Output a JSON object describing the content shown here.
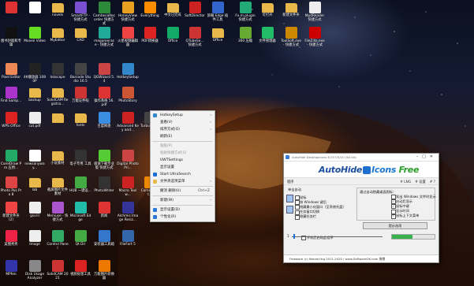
{
  "desktop": {
    "icons": [
      {
        "label": "",
        "icon": "app-icon",
        "color": "#d33"
      },
      {
        "label": "",
        "icon": "doc-icon",
        "color": "#fff"
      },
      {
        "label": "novels",
        "icon": "folder-icon",
        "color": "#e8b84a"
      },
      {
        "label": "SmartFTP - 快捷方式",
        "icon": "app-icon",
        "color": "#7a4fd0"
      },
      {
        "label": "CamtasiaRecorder 快捷方式",
        "icon": "app-icon",
        "color": "#2d8a3a"
      },
      {
        "label": "HoneyView 快捷方式",
        "icon": "app-icon",
        "color": "#e8a020"
      },
      {
        "label": "Everything",
        "icon": "search-icon",
        "color": "#ff8c00"
      },
      {
        "label": "中文已完成",
        "icon": "folder-icon",
        "color": "#e8b84a"
      },
      {
        "label": "SoftDirector",
        "icon": "app-icon",
        "color": "#c22"
      },
      {
        "label": "卸载 Edge 插件工具",
        "icon": "app-icon",
        "color": "#36c"
      },
      {
        "label": "Fx.m.plugin 快捷方式",
        "icon": "app-icon",
        "color": "#2a7"
      },
      {
        "label": "可打开",
        "icon": "folder-icon",
        "color": "#e8b84a"
      },
      {
        "label": "新建文件夹",
        "icon": "folder-icon",
        "color": "#e8b84a"
      },
      {
        "label": "Mp4Reader 快捷方式",
        "icon": "doc-icon",
        "color": "#eee"
      },
      {
        "label": "图书封面和专辑",
        "icon": "app-icon",
        "color": "#111"
      },
      {
        "label": "Moneil Video",
        "icon": "app-icon",
        "color": "#6d2"
      },
      {
        "label": "MyEditor",
        "icon": "folder-icon",
        "color": "#e8b84a"
      },
      {
        "label": "CAD",
        "icon": "folder-icon",
        "color": "#e8b84a"
      },
      {
        "label": "megamerase - 快捷方式",
        "icon": "app-icon",
        "color": "#2a9"
      },
      {
        "label": "火星视频编辑器",
        "icon": "app-icon",
        "color": "#e44"
      },
      {
        "label": "PDF转换器",
        "icon": "app-icon",
        "color": "#d22"
      },
      {
        "label": "Office",
        "icon": "app-icon",
        "color": "#1a6"
      },
      {
        "label": "QTubeSe... 快捷方式",
        "icon": "app-icon",
        "color": "#c33"
      },
      {
        "label": "Office",
        "icon": "folder-icon",
        "color": "#e8b84a"
      },
      {
        "label": "360 压缩",
        "icon": "app-icon",
        "color": "#6a3"
      },
      {
        "label": "文件管理器",
        "icon": "app-icon",
        "color": "#2b6"
      },
      {
        "label": "ToolSoft.exe - 快捷方式",
        "icon": "app-icon",
        "color": "#c80"
      },
      {
        "label": "FileZilla.exe - 快捷方式",
        "icon": "app-icon",
        "color": "#c00"
      },
      {
        "label": "Pixel Editor",
        "icon": "app-icon",
        "color": "#e85"
      },
      {
        "label": "4K播放器 1080P",
        "icon": "app-icon",
        "color": "#222"
      },
      {
        "label": "Inkscape",
        "icon": "app-icon",
        "color": "#333"
      },
      {
        "label": "Barcode Studio 16.5",
        "icon": "app-icon",
        "color": "#444"
      },
      {
        "label": "QGWizard 5.4",
        "icon": "app-icon",
        "color": "#c44"
      },
      {
        "label": "HotkeySetup",
        "icon": "app-icon",
        "color": "#38c"
      },
      {
        "label": "Find Samp...",
        "icon": "app-icon",
        "color": "#a3c"
      },
      {
        "label": "backup",
        "icon": "folder-icon",
        "color": "#e8b84a"
      },
      {
        "label": "SolidCAM Registra...",
        "icon": "folder-icon",
        "color": "#e8b84a"
      },
      {
        "label": "万能证件照",
        "icon": "app-icon",
        "color": "#c33"
      },
      {
        "label": "操作系统 56.pdf",
        "icon": "app-icon",
        "color": "#d33"
      },
      {
        "label": "PhotoStory",
        "icon": "app-icon",
        "color": "#c53"
      },
      {
        "label": "WPS Office",
        "icon": "app-icon",
        "color": "#d22"
      },
      {
        "label": "cut.pdf",
        "icon": "doc-icon",
        "color": "#eee"
      },
      {
        "label": "",
        "icon": "folder-icon",
        "color": "#e8b84a"
      },
      {
        "label": "fonts",
        "icon": "folder-icon",
        "color": "#e8b84a"
      },
      {
        "label": "百度网盘",
        "icon": "app-icon",
        "color": "#3a8de0"
      },
      {
        "label": "Advanced Key and...",
        "icon": "app-icon",
        "color": "#c22"
      },
      {
        "label": "TurboColl...",
        "icon": "app-icon",
        "color": "#444"
      },
      {
        "label": "CorelDraw Pro 应用...",
        "icon": "app-icon",
        "color": "#2a6"
      },
      {
        "label": "newsanyway...",
        "icon": "doc-icon",
        "color": "#fff"
      },
      {
        "label": "小说素材",
        "icon": "folder-icon",
        "color": "#e8b84a"
      },
      {
        "label": "电子专用 工具",
        "icon": "app-icon",
        "color": "#333"
      },
      {
        "label": "极速下载专业版 快捷方式",
        "icon": "app-icon",
        "color": "#5c3"
      },
      {
        "label": "Digital Photo Pri...",
        "icon": "app-icon",
        "color": "#c44"
      },
      {
        "label": "Photo Pos Pro 8",
        "icon": "app-icon",
        "color": "#d44"
      },
      {
        "label": "lab",
        "icon": "folder-icon",
        "color": "#e8b84a"
      },
      {
        "label": "截屏图片文件素材",
        "icon": "folder-icon",
        "color": "#e8b84a"
      },
      {
        "label": "HUB 一键设...",
        "icon": "app-icon",
        "color": "#4a4"
      },
      {
        "label": "PhotoWriter",
        "icon": "app-icon",
        "color": "#333"
      },
      {
        "label": "Macro Toolw...",
        "icon": "app-icon",
        "color": "#c22"
      },
      {
        "label": "Cornelicent...",
        "icon": "app-icon",
        "color": "#e80"
      },
      {
        "label": "新建文件夹 (2)",
        "icon": "app-icon",
        "color": "#e44"
      },
      {
        "label": "gsvril",
        "icon": "doc-icon",
        "color": "#eee"
      },
      {
        "label": "Mervuse - 快捷方式",
        "icon": "app-icon",
        "color": "#a5c"
      },
      {
        "label": "Microsoft Edge",
        "icon": "app-icon",
        "color": "#2ba"
      },
      {
        "label": "新闻",
        "icon": "app-icon",
        "color": "#d33"
      },
      {
        "label": "Alchmis Image Resiz...",
        "icon": "app-icon",
        "color": "#339"
      },
      {
        "label": "美图秀秀",
        "icon": "app-icon",
        "color": "#e24"
      },
      {
        "label": "Image",
        "icon": "doc-icon",
        "color": "#eee"
      },
      {
        "label": "Control Panel",
        "icon": "app-icon",
        "color": "#3a6"
      },
      {
        "label": "Qt Dir",
        "icon": "app-icon",
        "color": "#4a4"
      },
      {
        "label": "安装器工具箱",
        "icon": "app-icon",
        "color": "#37c"
      },
      {
        "label": "FileFort 5",
        "icon": "app-icon",
        "color": "#36a"
      },
      {
        "label": "MPfen",
        "icon": "app-icon",
        "color": "#33a"
      },
      {
        "label": "Disk Usage Analyzer",
        "icon": "app-icon",
        "color": "#888"
      },
      {
        "label": "SolidCAM 2021",
        "icon": "app-icon",
        "color": "#c33"
      },
      {
        "label": "视频处理工具",
        "icon": "app-icon",
        "color": "#d22"
      },
      {
        "label": "万能图片转换器",
        "icon": "app-icon",
        "color": "#e70"
      }
    ]
  },
  "context_menu": {
    "items": [
      {
        "label": "HotkeySetup",
        "icon": "app-icon",
        "icon_color": "#38c",
        "arrow": true,
        "disabled": false,
        "shortcut": ""
      },
      {
        "label": "查看(V)",
        "icon": "",
        "icon_color": "",
        "arrow": true,
        "disabled": false,
        "shortcut": ""
      },
      {
        "label": "排序方式(O)",
        "icon": "",
        "icon_color": "",
        "arrow": true,
        "disabled": false,
        "shortcut": ""
      },
      {
        "label": "刷新(E)",
        "icon": "",
        "icon_color": "",
        "arrow": false,
        "disabled": false,
        "shortcut": ""
      },
      {
        "sep": true
      },
      {
        "label": "粘贴(P)",
        "icon": "",
        "icon_color": "",
        "arrow": false,
        "disabled": true,
        "shortcut": ""
      },
      {
        "label": "粘贴快捷方式(S)",
        "icon": "",
        "icon_color": "",
        "arrow": false,
        "disabled": true,
        "shortcut": ""
      },
      {
        "label": "UWTSettings",
        "icon": "",
        "icon_color": "",
        "arrow": false,
        "disabled": false,
        "shortcut": ""
      },
      {
        "label": "显示设置",
        "icon": "",
        "icon_color": "",
        "arrow": false,
        "disabled": false,
        "shortcut": ""
      },
      {
        "label": "Start UltraSearch",
        "icon": "search-icon",
        "icon_color": "#1d6fd8",
        "arrow": false,
        "disabled": false,
        "shortcut": ""
      },
      {
        "label": "文件夹选项菜单",
        "icon": "folder-icon",
        "icon_color": "#e8b84a",
        "arrow": true,
        "disabled": false,
        "shortcut": ""
      },
      {
        "sep": true
      },
      {
        "label": "撤消 删除(U)",
        "icon": "",
        "icon_color": "",
        "arrow": false,
        "disabled": false,
        "shortcut": "Ctrl+Z"
      },
      {
        "sep": true
      },
      {
        "label": "新建(W)",
        "icon": "",
        "icon_color": "",
        "arrow": true,
        "disabled": false,
        "shortcut": ""
      },
      {
        "sep": true
      },
      {
        "label": "显示设置(D)",
        "icon": "monitor-icon",
        "icon_color": "#2b78d6",
        "arrow": false,
        "disabled": false,
        "shortcut": ""
      },
      {
        "label": "个性化(R)",
        "icon": "brush-icon",
        "icon_color": "#2b78d6",
        "arrow": false,
        "disabled": false,
        "shortcut": ""
      }
    ]
  },
  "autohide_window": {
    "title": "AutoHide DesktopIcons 6.03   OS/10 (64 bit)",
    "logo": {
      "part1": "AutoHide",
      "part2": "Icons",
      "part3": "Free"
    },
    "menu_left": "程序",
    "menu_right": [
      "# LNG",
      "# 设置",
      "# ?"
    ],
    "section_label": "单击自动",
    "left_options": [
      {
        "label": "鼠标",
        "checked": false
      },
      {
        "label": "按 Windows 键后",
        "checked": false
      },
      {
        "label": "隐藏最小化窗口（至系统托盘）",
        "checked": false
      },
      {
        "label": "任务窗口切换",
        "checked": false
      },
      {
        "label": "隐藏任务栏",
        "checked": false
      }
    ],
    "group_title": "通过自动隐藏桌面图标：",
    "right_options": [
      {
        "label": "发出 Windows 文件时显示",
        "checked": false
      },
      {
        "label": "启动后显示",
        "checked": true
      },
      {
        "label": "鼠标中键",
        "checked": true
      },
      {
        "label": "显示时间",
        "checked": false
      },
      {
        "label": "鼠标上下文菜单",
        "checked": true
      }
    ],
    "restore_button": "提示选项",
    "autostart_label": "开机后启动此程序",
    "slider_label": "1",
    "progress_fraction": 0.48,
    "status_text": "Freeware (c) Nenad Hrg 2011-2020 / www.SoftwareOK.com   捐赠"
  }
}
